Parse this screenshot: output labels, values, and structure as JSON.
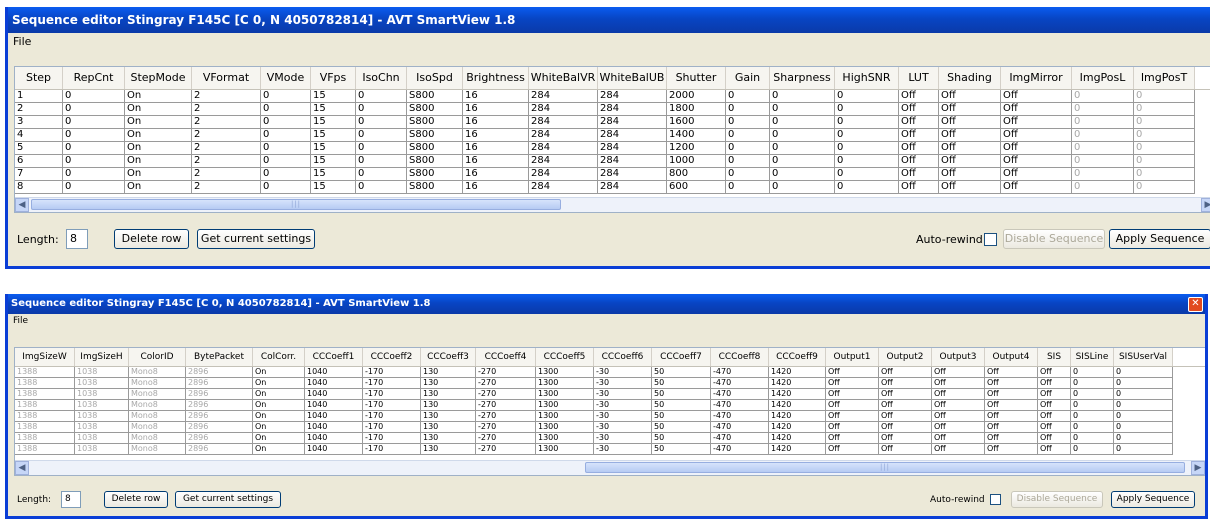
{
  "windows": [
    {
      "title": "Sequence editor Stingray F145C [C 0, N 4050782814] - AVT SmartView 1.8",
      "menu": "File",
      "columns": [
        "Step",
        "RepCnt",
        "StepMode",
        "VFormat",
        "VMode",
        "VFps",
        "IsoChn",
        "IsoSpd",
        "Brightness",
        "WhiteBalVR",
        "WhiteBalUB",
        "Shutter",
        "Gain",
        "Sharpness",
        "HighSNR",
        "LUT",
        "Shading",
        "ImgMirror",
        "ImgPosL",
        "ImgPosT"
      ],
      "rows": [
        [
          "1",
          "0",
          "On",
          "2",
          "0",
          "15",
          "0",
          "S800",
          "16",
          "284",
          "284",
          "2000",
          "0",
          "0",
          "0",
          "Off",
          "Off",
          "Off",
          "0",
          "0"
        ],
        [
          "2",
          "0",
          "On",
          "2",
          "0",
          "15",
          "0",
          "S800",
          "16",
          "284",
          "284",
          "1800",
          "0",
          "0",
          "0",
          "Off",
          "Off",
          "Off",
          "0",
          "0"
        ],
        [
          "3",
          "0",
          "On",
          "2",
          "0",
          "15",
          "0",
          "S800",
          "16",
          "284",
          "284",
          "1600",
          "0",
          "0",
          "0",
          "Off",
          "Off",
          "Off",
          "0",
          "0"
        ],
        [
          "4",
          "0",
          "On",
          "2",
          "0",
          "15",
          "0",
          "S800",
          "16",
          "284",
          "284",
          "1400",
          "0",
          "0",
          "0",
          "Off",
          "Off",
          "Off",
          "0",
          "0"
        ],
        [
          "5",
          "0",
          "On",
          "2",
          "0",
          "15",
          "0",
          "S800",
          "16",
          "284",
          "284",
          "1200",
          "0",
          "0",
          "0",
          "Off",
          "Off",
          "Off",
          "0",
          "0"
        ],
        [
          "6",
          "0",
          "On",
          "2",
          "0",
          "15",
          "0",
          "S800",
          "16",
          "284",
          "284",
          "1000",
          "0",
          "0",
          "0",
          "Off",
          "Off",
          "Off",
          "0",
          "0"
        ],
        [
          "7",
          "0",
          "On",
          "2",
          "0",
          "15",
          "0",
          "S800",
          "16",
          "284",
          "284",
          "800",
          "0",
          "0",
          "0",
          "Off",
          "Off",
          "Off",
          "0",
          "0"
        ],
        [
          "8",
          "0",
          "On",
          "2",
          "0",
          "15",
          "0",
          "S800",
          "16",
          "284",
          "284",
          "600",
          "0",
          "0",
          "0",
          "Off",
          "Off",
          "Off",
          "0",
          "0"
        ]
      ],
      "gray_columns": [
        18,
        19
      ],
      "length_label": "Length:",
      "length_value": "8",
      "delete_row": "Delete row",
      "get_current": "Get current settings",
      "auto_rewind": "Auto-rewind",
      "disable_sequence": "Disable Sequence",
      "apply_sequence": "Apply Sequence"
    },
    {
      "title": "Sequence editor Stingray F145C [C 0, N 4050782814] - AVT SmartView 1.8",
      "menu": "File",
      "columns": [
        "ImgSizeW",
        "ImgSizeH",
        "ColorID",
        "BytePacket",
        "ColCorr.",
        "CCCoeff1",
        "CCCoeff2",
        "CCCoeff3",
        "CCCoeff4",
        "CCCoeff5",
        "CCCoeff6",
        "CCCoeff7",
        "CCCoeff8",
        "CCCoeff9",
        "Output1",
        "Output2",
        "Output3",
        "Output4",
        "SIS",
        "SISLine",
        "SISUserVal"
      ],
      "rows": [
        [
          "1388",
          "1038",
          "Mono8",
          "2896",
          "On",
          "1040",
          "-170",
          "130",
          "-270",
          "1300",
          "-30",
          "50",
          "-470",
          "1420",
          "Off",
          "Off",
          "Off",
          "Off",
          "Off",
          "0",
          "0"
        ],
        [
          "1388",
          "1038",
          "Mono8",
          "2896",
          "On",
          "1040",
          "-170",
          "130",
          "-270",
          "1300",
          "-30",
          "50",
          "-470",
          "1420",
          "Off",
          "Off",
          "Off",
          "Off",
          "Off",
          "0",
          "0"
        ],
        [
          "1388",
          "1038",
          "Mono8",
          "2896",
          "On",
          "1040",
          "-170",
          "130",
          "-270",
          "1300",
          "-30",
          "50",
          "-470",
          "1420",
          "Off",
          "Off",
          "Off",
          "Off",
          "Off",
          "0",
          "0"
        ],
        [
          "1388",
          "1038",
          "Mono8",
          "2896",
          "On",
          "1040",
          "-170",
          "130",
          "-270",
          "1300",
          "-30",
          "50",
          "-470",
          "1420",
          "Off",
          "Off",
          "Off",
          "Off",
          "Off",
          "0",
          "0"
        ],
        [
          "1388",
          "1038",
          "Mono8",
          "2896",
          "On",
          "1040",
          "-170",
          "130",
          "-270",
          "1300",
          "-30",
          "50",
          "-470",
          "1420",
          "Off",
          "Off",
          "Off",
          "Off",
          "Off",
          "0",
          "0"
        ],
        [
          "1388",
          "1038",
          "Mono8",
          "2896",
          "On",
          "1040",
          "-170",
          "130",
          "-270",
          "1300",
          "-30",
          "50",
          "-470",
          "1420",
          "Off",
          "Off",
          "Off",
          "Off",
          "Off",
          "0",
          "0"
        ],
        [
          "1388",
          "1038",
          "Mono8",
          "2896",
          "On",
          "1040",
          "-170",
          "130",
          "-270",
          "1300",
          "-30",
          "50",
          "-470",
          "1420",
          "Off",
          "Off",
          "Off",
          "Off",
          "Off",
          "0",
          "0"
        ],
        [
          "1388",
          "1038",
          "Mono8",
          "2896",
          "On",
          "1040",
          "-170",
          "130",
          "-270",
          "1300",
          "-30",
          "50",
          "-470",
          "1420",
          "Off",
          "Off",
          "Off",
          "Off",
          "Off",
          "0",
          "0"
        ]
      ],
      "gray_columns": [
        0,
        1,
        2,
        3
      ],
      "length_label": "Length:",
      "length_value": "8",
      "delete_row": "Delete row",
      "get_current": "Get current settings",
      "auto_rewind": "Auto-rewind",
      "disable_sequence": "Disable Sequence",
      "apply_sequence": "Apply Sequence"
    }
  ]
}
